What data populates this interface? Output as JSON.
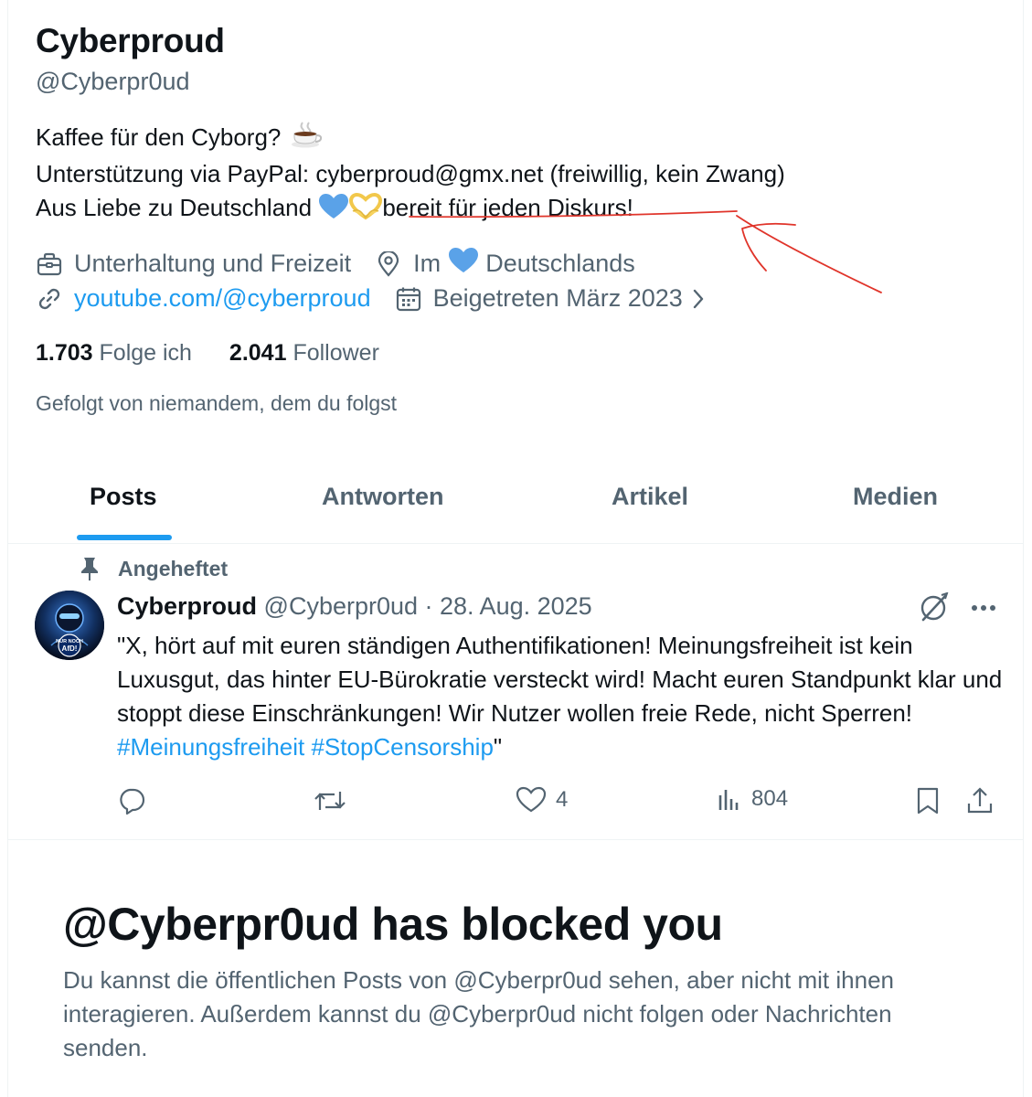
{
  "profile": {
    "name": "Cyberproud",
    "handle": "@Cyberpr0ud",
    "bio": {
      "line1": "Kaffee für den Cyborg?",
      "line1_icon": "coffee-cup-icon",
      "line2": "Unterstützung via PayPal: cyberproud@gmx.net (freiwillig, kein Zwang)",
      "line3_before": "Aus Liebe zu Deutschland",
      "line3_icons": [
        "blue-heart-icon",
        "heart-hands-icon"
      ],
      "line3_after": "bereit für jeden Diskurs!"
    },
    "category": "Unterhaltung und Freizeit",
    "location_before": "Im",
    "location_icon": "blue-heart-icon",
    "location_after": "Deutschlands",
    "website": "youtube.com/@cyberproud",
    "joined": "Beigetreten März 2023",
    "following_count": "1.703",
    "following_label": "Folge ich",
    "followers_count": "2.041",
    "followers_label": "Follower",
    "followed_by": "Gefolgt von niemandem, dem du folgst"
  },
  "tabs": [
    {
      "label": "Posts",
      "active": true
    },
    {
      "label": "Antworten",
      "active": false
    },
    {
      "label": "Artikel",
      "active": false
    },
    {
      "label": "Medien",
      "active": false
    }
  ],
  "pinned_post": {
    "pinned_label": "Angeheftet",
    "author": "Cyberproud",
    "meta": "@Cyberpr0ud · 28. Aug. 2025",
    "avatar_text": "NUR NOCH AfD!",
    "text": "\"X, hört auf mit euren ständigen Authentifikationen! Meinungsfreiheit ist kein Luxusgut, das hinter EU-Bürokratie versteckt wird! Macht euren Standpunkt klar und stoppt diese Einschränkungen! Wir Nutzer wollen freie Rede, nicht Sperren! ",
    "hashtags": "#Meinungsfreiheit #StopCensorship",
    "text_end": "\"",
    "likes": "4",
    "views": "804"
  },
  "blocked": {
    "title": "@Cyberpr0ud has blocked you",
    "text": "Du kannst die öffentlichen Posts von @Cyberpr0ud sehen, aber nicht mit ihnen interagieren. Außerdem kannst du @Cyberpr0ud nicht folgen oder Nachrichten senden."
  },
  "colors": {
    "accent": "#1d9bf0",
    "secondary_text": "#536471",
    "primary_text": "#0f1419",
    "annotation": "#e0342a"
  }
}
